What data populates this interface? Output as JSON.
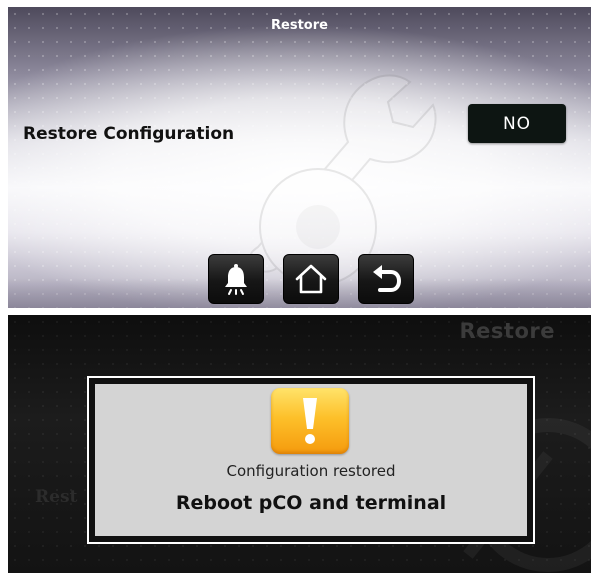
{
  "screen_top": {
    "title": "Restore",
    "row": {
      "label": "Restore Configuration",
      "value": "NO"
    },
    "nav": [
      {
        "name": "alarm",
        "icon": "bell-icon"
      },
      {
        "name": "home",
        "icon": "home-icon"
      },
      {
        "name": "back",
        "icon": "back-arrow-icon"
      }
    ]
  },
  "screen_bottom": {
    "title": "Restore",
    "background_label": "Rest",
    "dialog": {
      "icon": "warning-icon",
      "message": "Configuration restored",
      "instruction": "Reboot pCO and terminal"
    }
  },
  "colors": {
    "value_button_bg": "#0d1512",
    "warning_orange": "#f59a0d",
    "warning_yellow": "#ffe36a",
    "dialog_bg": "#d4d4d4"
  }
}
